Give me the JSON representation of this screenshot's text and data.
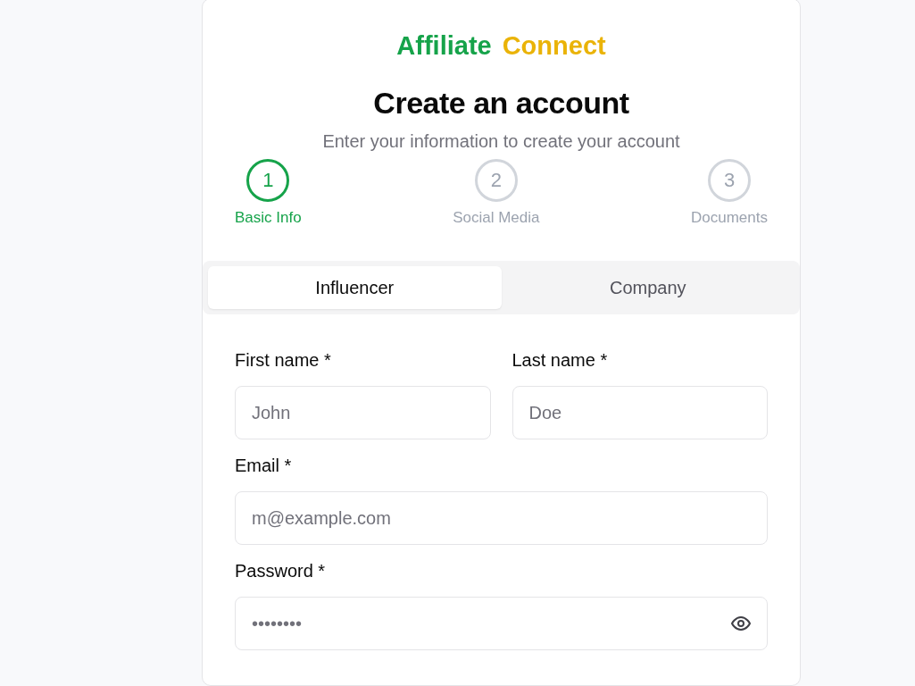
{
  "brand": {
    "primary": "Affiliate",
    "secondary": "Connect"
  },
  "heading": "Create an account",
  "subheading": "Enter your information to create your account",
  "steps": [
    {
      "number": "1",
      "label": "Basic Info",
      "selected": true
    },
    {
      "number": "2",
      "label": "Social Media",
      "selected": false
    },
    {
      "number": "3",
      "label": "Documents",
      "selected": false
    }
  ],
  "tabs": [
    {
      "label": "Influencer",
      "selected": true
    },
    {
      "label": "Company",
      "selected": false
    }
  ],
  "field_rows": [
    [
      {
        "label": "First name *",
        "placeholder": "John",
        "kind": "text"
      },
      {
        "label": "Last name *",
        "placeholder": "Doe",
        "kind": "text"
      }
    ],
    [
      {
        "label": "Email *",
        "placeholder": "m@example.com",
        "kind": "text"
      }
    ],
    [
      {
        "label": "Password *",
        "placeholder": "••••••••",
        "kind": "password"
      }
    ]
  ]
}
